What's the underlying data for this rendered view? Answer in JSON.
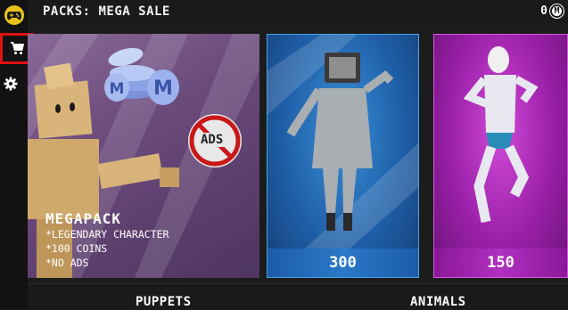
{
  "header": {
    "title": "PACKS: MEGA SALE",
    "coins": "0",
    "coin_symbol": "M"
  },
  "sidebar": {
    "items": [
      {
        "name": "logo"
      },
      {
        "name": "shop"
      },
      {
        "name": "settings"
      }
    ]
  },
  "packs": [
    {
      "name": "MEGAPACK",
      "features": [
        "*LEGENDARY CHARACTER",
        "*100 COINS",
        "*NO ADS"
      ],
      "badge": "ADS"
    },
    {
      "price": "300",
      "color": "#2a78c8"
    },
    {
      "price": "150",
      "color": "#b030c0"
    }
  ],
  "categories": [
    "PUPPETS",
    "ANIMALS"
  ]
}
